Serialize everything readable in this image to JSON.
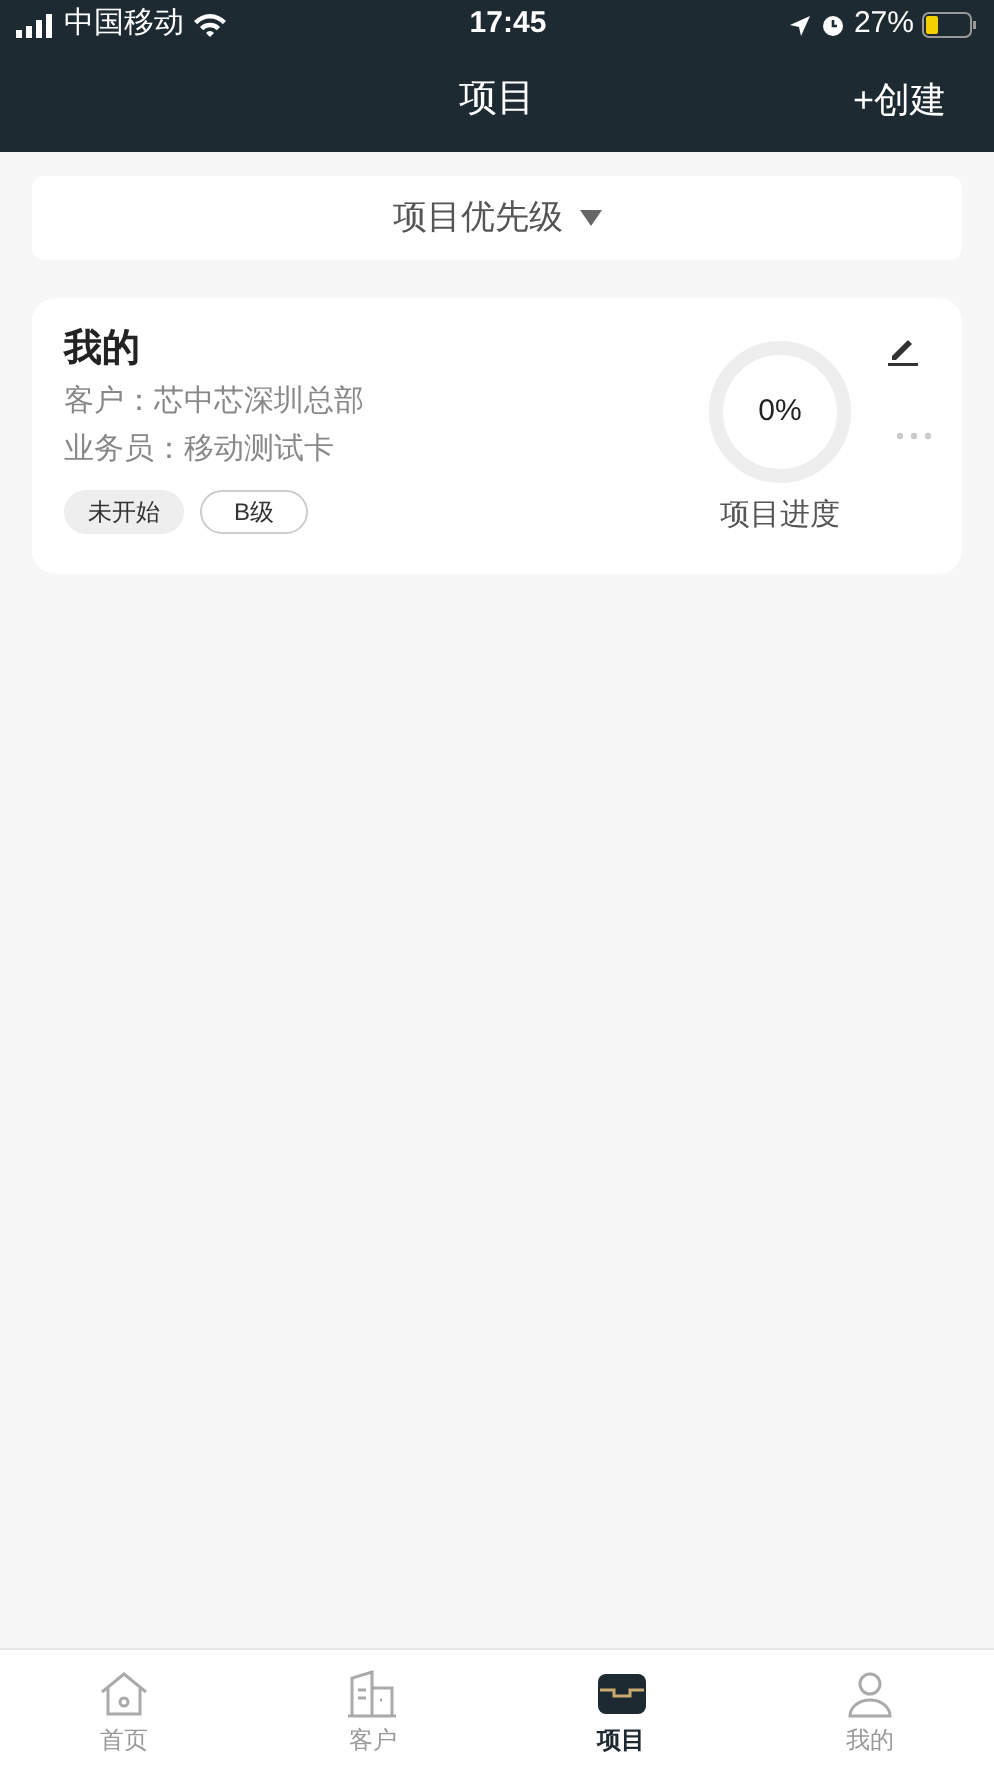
{
  "status_bar": {
    "carrier": "中国移动",
    "time": "17:45",
    "battery": "27%"
  },
  "nav_bar": {
    "title": "项目",
    "action": "+创建"
  },
  "filter": {
    "label": "项目优先级"
  },
  "projects": [
    {
      "name": "我的",
      "customer": "客户：芯中芯深圳总部",
      "salesperson": "业务员：移动测试卡",
      "status": "未开始",
      "grade": "B级",
      "progress": {
        "level": 0,
        "reading": "0%",
        "label": "项目进度"
      }
    }
  ],
  "tab_bar": [
    {
      "kind": "home",
      "label": "首页",
      "selected": false
    },
    {
      "kind": "customer",
      "label": "客户",
      "selected": false
    },
    {
      "kind": "project",
      "label": "项目",
      "selected": true
    },
    {
      "kind": "me",
      "label": "我的",
      "selected": false
    }
  ]
}
